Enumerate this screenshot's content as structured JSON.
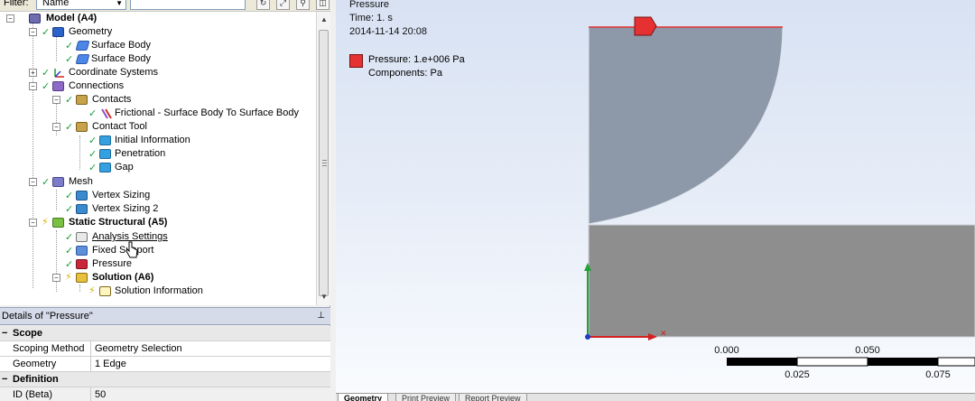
{
  "filter": {
    "label": "Filter:",
    "selected": "Name"
  },
  "tree": {
    "items": [
      {
        "label": "Model (A4)"
      },
      {
        "label": "Geometry"
      },
      {
        "label": "Surface Body"
      },
      {
        "label": "Surface Body"
      },
      {
        "label": "Coordinate Systems"
      },
      {
        "label": "Connections"
      },
      {
        "label": "Contacts"
      },
      {
        "label": "Frictional - Surface Body To Surface Body"
      },
      {
        "label": "Contact Tool"
      },
      {
        "label": "Initial Information"
      },
      {
        "label": "Penetration"
      },
      {
        "label": "Gap"
      },
      {
        "label": "Mesh"
      },
      {
        "label": "Vertex Sizing"
      },
      {
        "label": "Vertex Sizing 2"
      },
      {
        "label": "Static Structural (A5)"
      },
      {
        "label": "Analysis Settings"
      },
      {
        "label": "Fixed Support"
      },
      {
        "label": "Pressure"
      },
      {
        "label": "Solution (A6)"
      },
      {
        "label": "Solution Information"
      }
    ]
  },
  "details": {
    "title": "Details of \"Pressure\"",
    "rows": [
      {
        "label": "Scope"
      },
      {
        "key": "Scoping Method",
        "value": "Geometry Selection"
      },
      {
        "key": "Geometry",
        "value": "1 Edge"
      },
      {
        "label": "Definition"
      },
      {
        "key": "ID (Beta)",
        "value": "50"
      }
    ]
  },
  "viewport": {
    "title": "Pressure",
    "time": "Time: 1. s",
    "date": "2014-11-14 20:08",
    "legend_value": "Pressure: 1.e+006 Pa",
    "legend_components": "Components:  Pa",
    "accent_color": "#e53131"
  },
  "scale_bar": {
    "labels_top": [
      "0.000",
      "0.050"
    ],
    "labels_bottom": [
      "0.025",
      "0.075"
    ]
  },
  "tabs": [
    "Geometry",
    "Print Preview",
    "Report Preview"
  ]
}
